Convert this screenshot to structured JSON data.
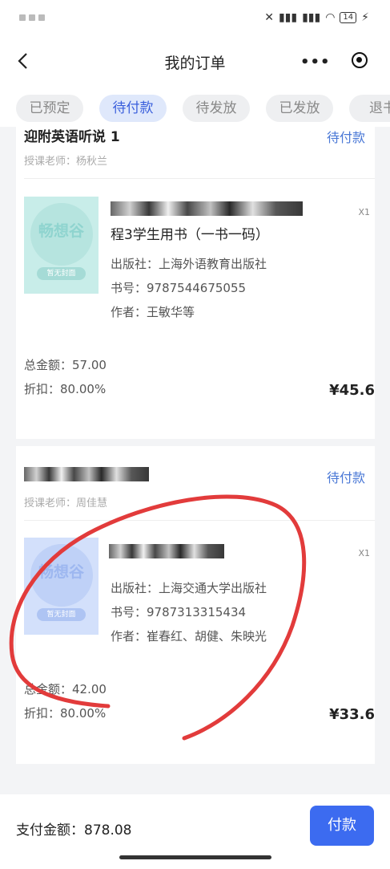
{
  "nav": {
    "title": "我的订单",
    "more_label": "•••"
  },
  "status_bar": {
    "battery": "14"
  },
  "tabs": [
    {
      "label": "已预定"
    },
    {
      "label": "待付款",
      "active": true
    },
    {
      "label": "待发放"
    },
    {
      "label": "已发放"
    },
    {
      "label": "退书"
    }
  ],
  "orders": [
    {
      "course_title": "迎附英语听说 1",
      "teacher": "授课老师：杨秋兰",
      "status": "待付款",
      "book": {
        "cover_logo": "畅想谷",
        "cover_label": "暂无封面",
        "qty": "X1",
        "name": "程3学生用书（一书一码）",
        "publisher": "出版社：上海外语教育出版社",
        "isbn": "书号：9787544675055",
        "author": "作者：王敏华等"
      },
      "total": "总金额：57.00",
      "discount": "折扣：80.00%",
      "price": "¥45.6"
    },
    {
      "course_title": "",
      "teacher": "授课老师：周佳慧",
      "status": "待付款",
      "book": {
        "cover_logo": "畅想谷",
        "cover_label": "暂无封面",
        "qty": "X1",
        "name": "",
        "publisher": "出版社：上海交通大学出版社",
        "isbn": "书号：9787313315434",
        "author": "作者：崔春红、胡健、朱映光"
      },
      "total": "总金额：42.00",
      "discount": "折扣：80.00%",
      "price": "¥33.6"
    }
  ],
  "footer": {
    "total_label": "支付金额：878.08",
    "pay_button": "付款"
  },
  "colors": {
    "accent": "#3c6bf0",
    "status": "#4a78d6",
    "annotation": "#e23b3b"
  }
}
